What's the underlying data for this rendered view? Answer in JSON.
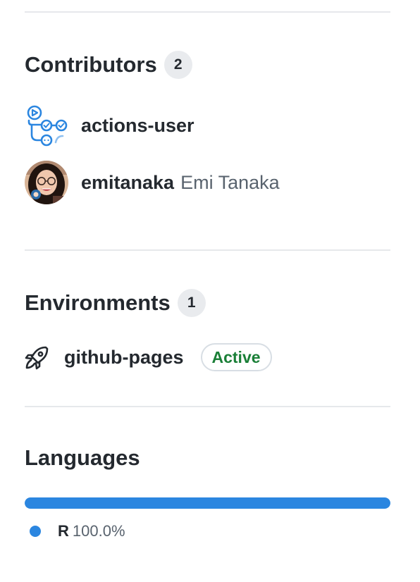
{
  "contributors": {
    "title": "Contributors",
    "count": "2",
    "people": [
      {
        "login": "actions-user",
        "name": "",
        "avatar_icon": "github-actions-icon"
      },
      {
        "login": "emitanaka",
        "name": "Emi Tanaka",
        "avatar_icon": "profile-photo"
      }
    ]
  },
  "environments": {
    "title": "Environments",
    "count": "1",
    "items": [
      {
        "name": "github-pages",
        "status": "Active",
        "icon": "rocket-icon"
      }
    ]
  },
  "languages": {
    "title": "Languages",
    "items": [
      {
        "name": "R",
        "percent": "100.0%",
        "fraction": 1.0,
        "color": "#2b86e0"
      }
    ]
  },
  "colors": {
    "actions_blue": "#2b86e0",
    "active_green": "#1a7f37"
  }
}
